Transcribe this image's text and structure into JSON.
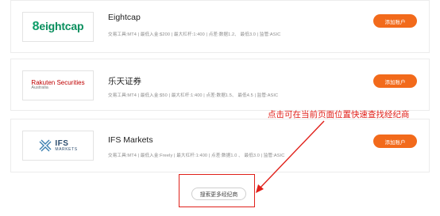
{
  "brokers": [
    {
      "name": "Eightcap",
      "meta": "交易工具:MT4 | 最低入金:$200 | 最大杠杆:1:400 | 点差:数据1.2、 最低3.0 | 监管:ASIC",
      "button": "添加账户",
      "logo": {
        "mark": "8",
        "text": "eightcap",
        "color": "#0a8f5e"
      }
    },
    {
      "name": "乐天证券",
      "meta": "交易工具:MT4 | 最低入金:$50 | 最大杠杆:1:400 | 点差:数据1.5、 最低4.5 | 监管:ASIC",
      "button": "添加账户",
      "logo": {
        "line1": "Rakuten Securities",
        "line2": "Australia",
        "color": "#bf0000"
      }
    },
    {
      "name": "IFS Markets",
      "meta": "交易工具:MT4 | 最低入金:Freely | 最大杠杆:1:400 | 点差:数据1.0 、 最低3.0 | 监管:ASIC",
      "button": "添加账户",
      "logo": {
        "line1": "IFS",
        "line2": "MARKETS",
        "color": "#2a4c6e"
      }
    }
  ],
  "annotation": "点击可在当前页面位置快速查找经纪商",
  "more_button": "搜索更多经纪商",
  "colors": {
    "accent": "#f26a1b",
    "annotation": "#e0201a"
  }
}
